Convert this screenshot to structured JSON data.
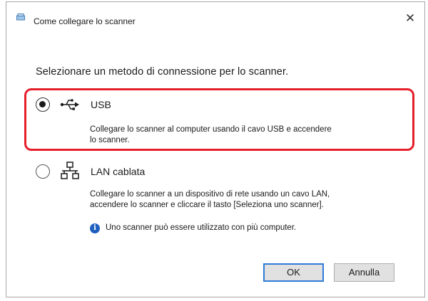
{
  "window": {
    "title": "Come collegare lo scanner",
    "close_glyph": "✕"
  },
  "prompt": "Selezionare un metodo di connessione per lo scanner.",
  "options": [
    {
      "label": "USB",
      "icon": "usb-icon",
      "selected": true,
      "description_lines": [
        "Collegare lo scanner al computer usando il cavo USB e accendere",
        "lo scanner."
      ]
    },
    {
      "label": "LAN cablata",
      "icon": "network-icon",
      "selected": false,
      "description_lines": [
        "Collegare lo scanner a un dispositivo di rete usando un cavo LAN,",
        "accendere lo scanner e cliccare il tasto [Seleziona uno scanner]."
      ]
    }
  ],
  "info": {
    "icon": "info-icon",
    "glyph": "i",
    "text": "Uno scanner può essere utilizzato con più computer."
  },
  "buttons": {
    "ok": "OK",
    "cancel": "Annulla"
  },
  "colors": {
    "highlight": "#e6202b",
    "default_button_border": "#2f7bd6",
    "info_icon": "#1f5fbf"
  }
}
